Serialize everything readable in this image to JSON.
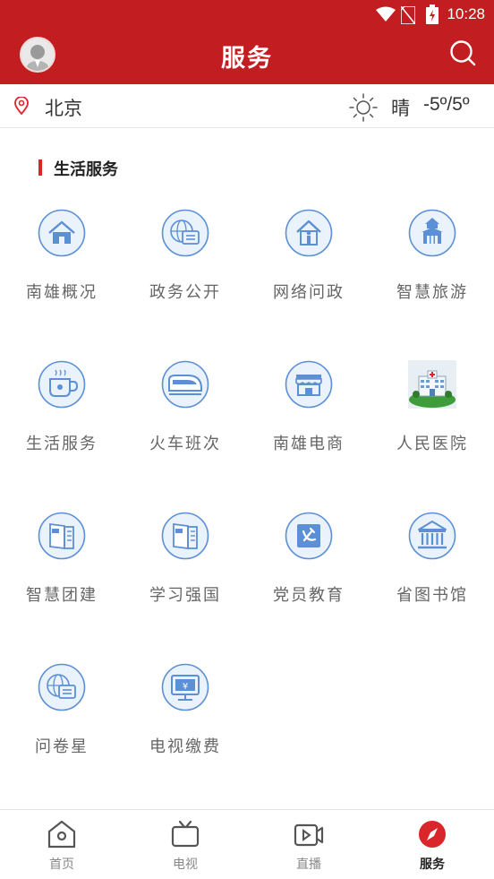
{
  "status_bar": {
    "time": "10:28"
  },
  "header": {
    "title": "服务"
  },
  "location": {
    "city": "北京",
    "weather": "晴",
    "temperature": "-5º/5º"
  },
  "section": {
    "title": "生活服务"
  },
  "services": [
    {
      "label": "南雄概况",
      "icon": "house-icon"
    },
    {
      "label": "政务公开",
      "icon": "globe-document-icon"
    },
    {
      "label": "网络问政",
      "icon": "house-person-icon"
    },
    {
      "label": "智慧旅游",
      "icon": "temple-icon"
    },
    {
      "label": "生活服务",
      "icon": "coffee-cup-icon"
    },
    {
      "label": "火车班次",
      "icon": "train-icon"
    },
    {
      "label": "南雄电商",
      "icon": "shop-icon"
    },
    {
      "label": "人民医院",
      "icon": "hospital-icon"
    },
    {
      "label": "智慧团建",
      "icon": "flag-book-icon"
    },
    {
      "label": "学习强国",
      "icon": "flag-book-icon"
    },
    {
      "label": "党员教育",
      "icon": "party-emblem-icon"
    },
    {
      "label": "省图书馆",
      "icon": "library-building-icon"
    },
    {
      "label": "问卷星",
      "icon": "globe-document-icon"
    },
    {
      "label": "电视缴费",
      "icon": "tv-payment-icon"
    }
  ],
  "tabs": [
    {
      "label": "首页",
      "icon": "home-icon",
      "active": false
    },
    {
      "label": "电视",
      "icon": "tv-icon",
      "active": false
    },
    {
      "label": "直播",
      "icon": "video-icon",
      "active": false
    },
    {
      "label": "服务",
      "icon": "compass-icon",
      "active": true
    }
  ],
  "colors": {
    "brand_red": "#c21e22",
    "icon_blue": "#5b8fd6",
    "icon_fill": "#eaf2fb"
  }
}
